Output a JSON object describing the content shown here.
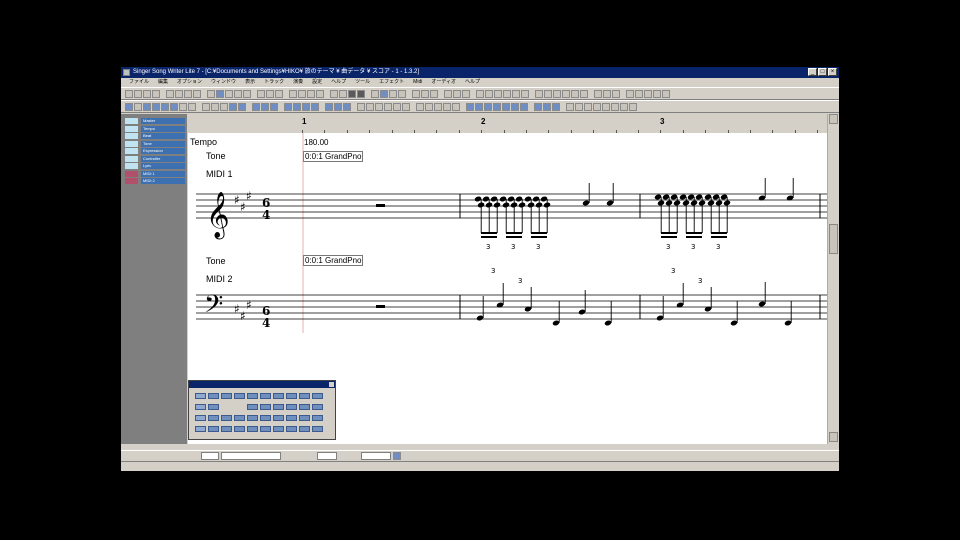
{
  "window": {
    "title": "Singer Song Writer Lite 7 - [C:¥Documents and Settings¥HIKO¥ 旅のテーマ ¥ 曲データ ¥ スコア - 1 - 1.3.2]"
  },
  "menubar": {
    "items": [
      "ファイル",
      "編集",
      "オプション",
      "ウィンドウ",
      "表示",
      "トラック",
      "演奏",
      "設定",
      "ヘルプ",
      "ツール",
      "エフェクト",
      "Midi",
      "オーディオ",
      "ヘルプ"
    ]
  },
  "sidebar": {
    "tracks": [
      {
        "name": "Master",
        "color": "#bfe3f0"
      },
      {
        "name": "Tempo",
        "color": "#bfe3f0"
      },
      {
        "name": "Beat",
        "color": "#bfe3f0"
      },
      {
        "name": "Tone",
        "color": "#bfe3f0"
      },
      {
        "name": "Expression",
        "color": "#bfe3f0"
      },
      {
        "name": "Controller",
        "color": "#bfe3f0"
      },
      {
        "name": "Lyric",
        "color": "#bfe3f0"
      },
      {
        "name": "MIDI 1",
        "color": "#b0506a"
      },
      {
        "name": "MIDI 2",
        "color": "#b0506a"
      }
    ]
  },
  "ruler": {
    "measures": [
      "1",
      "2",
      "3"
    ]
  },
  "score": {
    "tempo_label": "Tempo",
    "tempo_value": "180.00",
    "tone1_label": "Tone",
    "tone1_value": "0:0:1 GrandPno",
    "midi1_label": "MIDI 1",
    "tone2_label": "Tone",
    "tone2_value": "0:0:1 GrandPno",
    "midi2_label": "MIDI 2",
    "time_signature_top": "6",
    "time_signature_bottom": "4",
    "tuplet_label": "3"
  },
  "palette": {
    "title": ""
  },
  "colors": {
    "titlebar": "#0a246a",
    "track_name": "#3c70b0",
    "button_blue": "#6f8fc4"
  }
}
